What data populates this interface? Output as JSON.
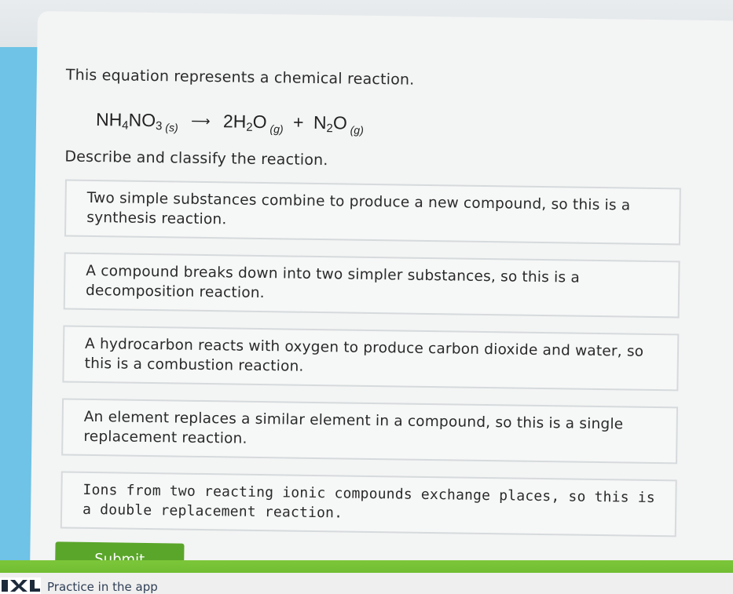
{
  "question": {
    "prompt": "This equation represents a chemical reaction.",
    "equation": {
      "reactant": {
        "base": "NH",
        "sub1": "4",
        "mid": "NO",
        "sub2": "3",
        "state": "(s)"
      },
      "arrow": "⟶",
      "product1": {
        "coef": "2",
        "base": "H",
        "sub": "2",
        "tail": "O",
        "state": "(g)"
      },
      "plus": "+",
      "product2": {
        "base": "N",
        "sub": "2",
        "tail": "O",
        "state": "(g)"
      }
    },
    "instruction": "Describe and classify the reaction."
  },
  "options": [
    "Two simple substances combine to produce a new compound, so this is a synthesis reaction.",
    "A compound breaks down into two simpler substances, so this is a decomposition reaction.",
    "A hydrocarbon reacts with oxygen to produce carbon dioxide and water, so this is a combustion reaction.",
    "An element replaces a similar element in a compound, so this is a single replacement reaction.",
    "Ions from two reacting ionic compounds exchange places, so this is a double replacement reaction."
  ],
  "submit_label": "Submit",
  "footer": {
    "practice_label": "Practice in the app",
    "logo_icon": "ixl-logo-icon"
  },
  "colors": {
    "accent_green": "#5aa62a",
    "background_blue": "#6ec3e6"
  }
}
